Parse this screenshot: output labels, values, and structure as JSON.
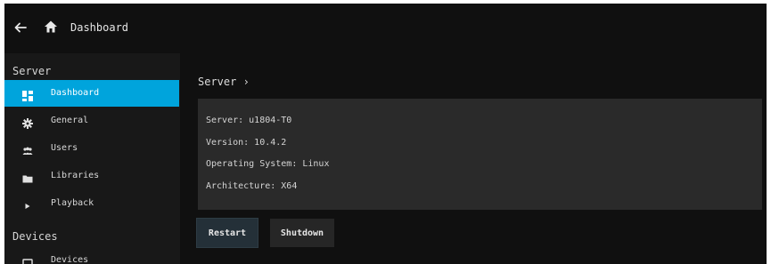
{
  "header": {
    "title": "Dashboard",
    "back_icon": "back-arrow-icon",
    "home_icon": "home-icon"
  },
  "sidebar": {
    "sections": [
      {
        "title": "Server",
        "items": [
          {
            "label": "Dashboard",
            "icon": "dashboard-icon",
            "active": true
          },
          {
            "label": "General",
            "icon": "gear-icon",
            "active": false
          },
          {
            "label": "Users",
            "icon": "users-icon",
            "active": false
          },
          {
            "label": "Libraries",
            "icon": "folder-icon",
            "active": false
          },
          {
            "label": "Playback",
            "icon": "play-icon",
            "active": false
          }
        ]
      },
      {
        "title": "Devices",
        "items": [
          {
            "label": "Devices",
            "icon": "devices-icon",
            "active": false
          }
        ]
      }
    ]
  },
  "main": {
    "breadcrumb": "Server ›",
    "info": {
      "server": "Server: u1804-T0",
      "version": "Version: 10.4.2",
      "os": "Operating System: Linux",
      "arch": "Architecture: X64"
    },
    "buttons": {
      "restart": "Restart",
      "shutdown": "Shutdown"
    }
  },
  "colors": {
    "accent": "#00a4dc",
    "background": "#101010",
    "sidebar": "#181818",
    "panel": "#2a2a2a"
  }
}
